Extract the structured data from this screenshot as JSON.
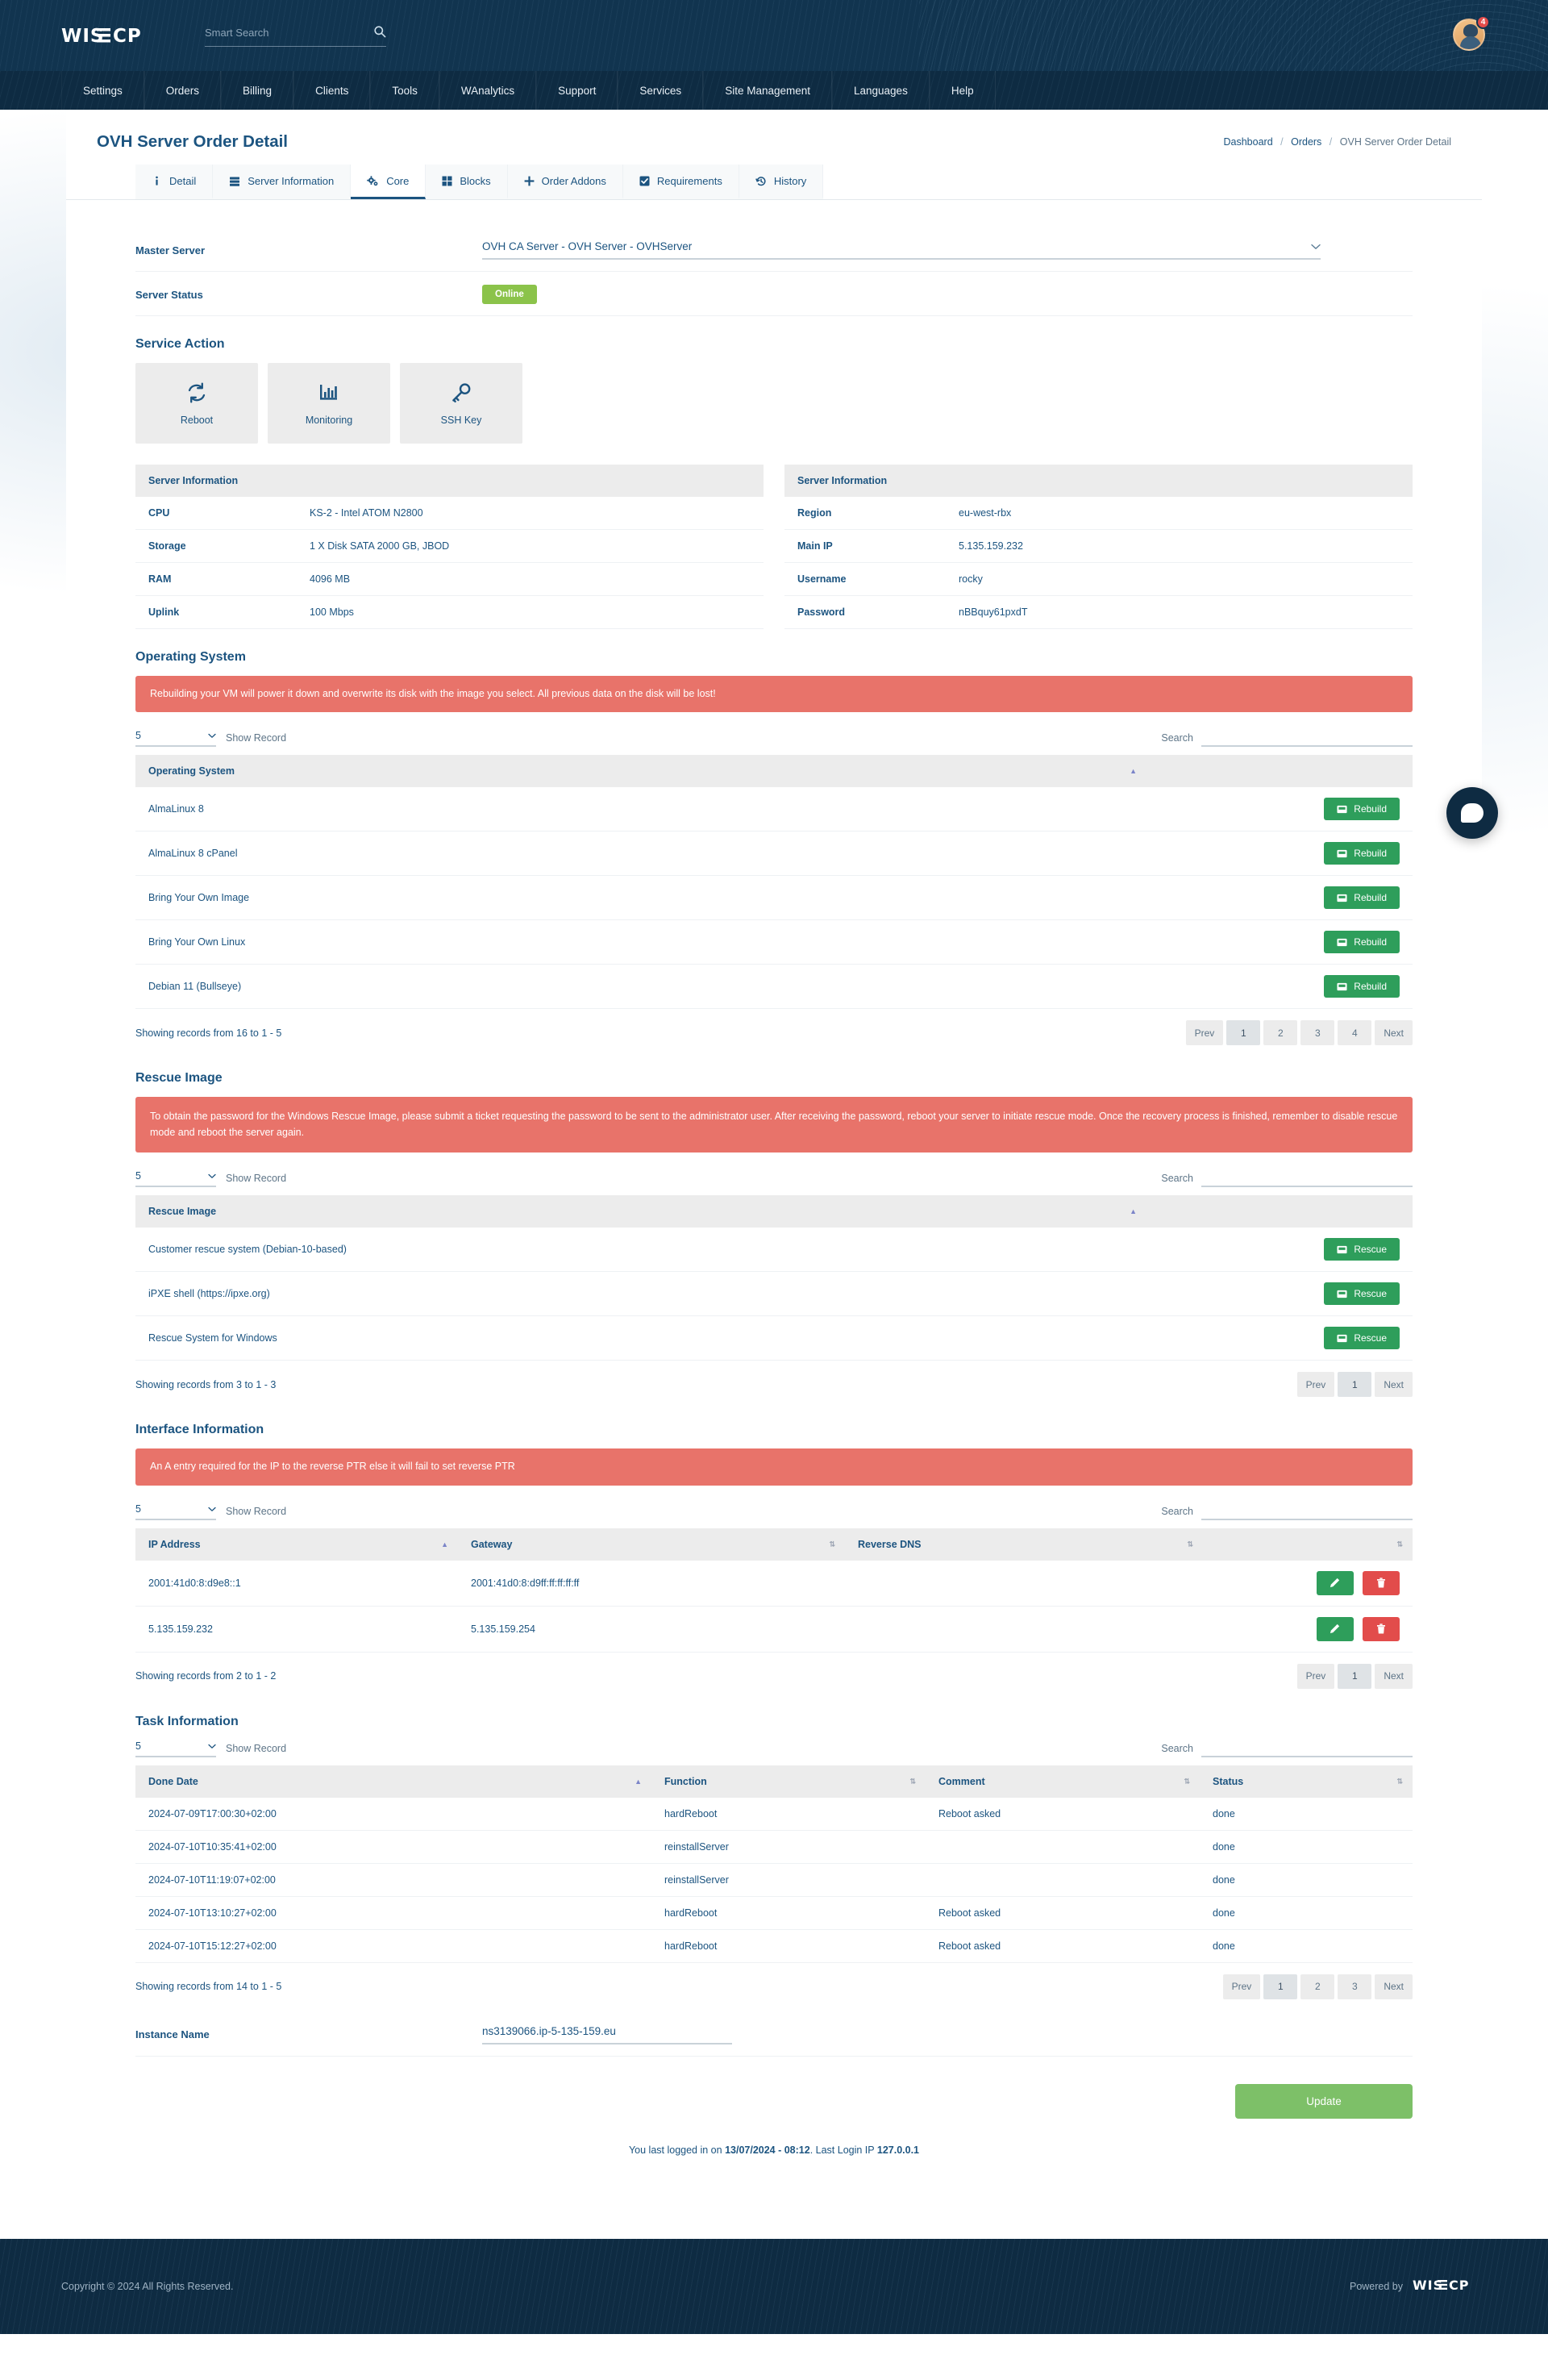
{
  "header": {
    "logo": "WISECP",
    "search_placeholder": "Smart Search",
    "search_value": "",
    "search_icon": "search-icon",
    "notification_count": "4"
  },
  "nav": {
    "items": [
      {
        "label": "Settings"
      },
      {
        "label": "Orders"
      },
      {
        "label": "Billing"
      },
      {
        "label": "Clients"
      },
      {
        "label": "Tools"
      },
      {
        "label": "WAnalytics"
      },
      {
        "label": "Support"
      },
      {
        "label": "Services"
      },
      {
        "label": "Site Management"
      },
      {
        "label": "Languages"
      },
      {
        "label": "Help"
      }
    ]
  },
  "page": {
    "title": "OVH Server Order Detail",
    "breadcrumb": {
      "root": "Dashboard",
      "mid": "Orders",
      "current": "OVH Server Order Detail"
    }
  },
  "tabs": [
    {
      "label": "Detail",
      "icon": "info-icon",
      "active": false
    },
    {
      "label": "Server Information",
      "icon": "server-icon",
      "active": false
    },
    {
      "label": "Core",
      "icon": "cogs-icon",
      "active": true
    },
    {
      "label": "Blocks",
      "icon": "blocks-icon",
      "active": false
    },
    {
      "label": "Order Addons",
      "icon": "plus-icon",
      "active": false
    },
    {
      "label": "Requirements",
      "icon": "check-square-icon",
      "active": false
    },
    {
      "label": "History",
      "icon": "history-icon",
      "active": false
    }
  ],
  "form": {
    "master_server_label": "Master Server",
    "master_server_value": "OVH CA Server - OVH Server - OVHServer",
    "server_status_label": "Server Status",
    "server_status_value": "Online",
    "instance_name_label": "Instance Name",
    "instance_name_value": "ns3139066.ip-5-135-159.eu"
  },
  "service_action": {
    "title": "Service Action",
    "cards": [
      {
        "label": "Reboot",
        "icon": "refresh-icon"
      },
      {
        "label": "Monitoring",
        "icon": "chart-bar-icon"
      },
      {
        "label": "SSH Key",
        "icon": "key-icon"
      }
    ]
  },
  "server_info_left": {
    "header": "Server Information",
    "rows": [
      {
        "key": "CPU",
        "value": "KS-2 - Intel ATOM N2800"
      },
      {
        "key": "Storage",
        "value": "1 X Disk SATA 2000 GB, JBOD"
      },
      {
        "key": "RAM",
        "value": "4096 MB"
      },
      {
        "key": "Uplink",
        "value": "100 Mbps"
      }
    ]
  },
  "server_info_right": {
    "header": "Server Information",
    "rows": [
      {
        "key": "Region",
        "value": "eu-west-rbx"
      },
      {
        "key": "Main IP",
        "value": "5.135.159.232"
      },
      {
        "key": "Username",
        "value": "rocky"
      },
      {
        "key": "Password",
        "value": "nBBquy61pxdT"
      }
    ]
  },
  "operating_system": {
    "title": "Operating System",
    "alert": "Rebuilding your VM will power it down and overwrite its disk with the image you select. All previous data on the disk will be lost!",
    "show_record_value": "5",
    "show_record_label": "Show Record",
    "search_label": "Search",
    "search_value": "",
    "column": "Operating System",
    "action_label": "Rebuild",
    "action_icon": "rebuild-icon",
    "rows": [
      {
        "name": "AlmaLinux 8"
      },
      {
        "name": "AlmaLinux 8 cPanel"
      },
      {
        "name": "Bring Your Own Image"
      },
      {
        "name": "Bring Your Own Linux"
      },
      {
        "name": "Debian 11 (Bullseye)"
      }
    ],
    "info": "Showing records from 16 to 1 - 5",
    "pager": [
      "Prev",
      "1",
      "2",
      "3",
      "4",
      "Next"
    ],
    "pager_active": "1"
  },
  "rescue_image": {
    "title": "Rescue Image",
    "alert": "To obtain the password for the Windows Rescue Image, please submit a ticket requesting the password to be sent to the administrator user. After receiving the password, reboot your server to initiate rescue mode. Once the recovery process is finished, remember to disable rescue mode and reboot the server again.",
    "show_record_value": "5",
    "show_record_label": "Show Record",
    "search_label": "Search",
    "search_value": "",
    "column": "Rescue Image",
    "action_label": "Rescue",
    "action_icon": "rescue-icon",
    "rows": [
      {
        "name": "Customer rescue system (Debian-10-based)"
      },
      {
        "name": "iPXE shell (https://ipxe.org)"
      },
      {
        "name": "Rescue System for Windows"
      }
    ],
    "info": "Showing records from 3 to 1 - 3",
    "pager": [
      "Prev",
      "1",
      "Next"
    ],
    "pager_active": "1"
  },
  "interface_information": {
    "title": "Interface Information",
    "alert": "An A entry required for the IP to the reverse PTR else it will fail to set reverse PTR",
    "show_record_value": "5",
    "show_record_label": "Show Record",
    "search_label": "Search",
    "search_value": "",
    "columns": [
      "IP Address",
      "Gateway",
      "Reverse DNS",
      ""
    ],
    "rows": [
      {
        "ip": "2001:41d0:8:d9e8::1",
        "gateway": "2001:41d0:8:d9ff:ff:ff:ff:ff",
        "rdns": ""
      },
      {
        "ip": "5.135.159.232",
        "gateway": "5.135.159.254",
        "rdns": ""
      }
    ],
    "edit_icon": "pencil-icon",
    "delete_icon": "trash-icon",
    "info": "Showing records from 2 to 1 - 2",
    "pager": [
      "Prev",
      "1",
      "Next"
    ],
    "pager_active": "1"
  },
  "task_information": {
    "title": "Task Information",
    "show_record_value": "5",
    "show_record_label": "Show Record",
    "search_label": "Search",
    "search_value": "",
    "columns": [
      "Done Date",
      "Function",
      "Comment",
      "Status"
    ],
    "rows": [
      {
        "date": "2024-07-09T17:00:30+02:00",
        "function": "hardReboot",
        "comment": "Reboot asked",
        "status": "done"
      },
      {
        "date": "2024-07-10T10:35:41+02:00",
        "function": "reinstallServer",
        "comment": "",
        "status": "done"
      },
      {
        "date": "2024-07-10T11:19:07+02:00",
        "function": "reinstallServer",
        "comment": "",
        "status": "done"
      },
      {
        "date": "2024-07-10T13:10:27+02:00",
        "function": "hardReboot",
        "comment": "Reboot asked",
        "status": "done"
      },
      {
        "date": "2024-07-10T15:12:27+02:00",
        "function": "hardReboot",
        "comment": "Reboot asked",
        "status": "done"
      }
    ],
    "info": "Showing records from 14 to 1 - 5",
    "pager": [
      "Prev",
      "1",
      "2",
      "3",
      "Next"
    ],
    "pager_active": "1"
  },
  "update_button": "Update",
  "last_login": {
    "prefix": "You last logged in on ",
    "date": "13/07/2024 - 08:12",
    "mid": ". Last Login IP ",
    "ip": "127.0.0.1"
  },
  "footer": {
    "copyright": "Copyright © 2024 All Rights Reserved.",
    "powered_by": "Powered by",
    "logo": "WISECP"
  },
  "chat": {
    "icon": "chat-bubble-icon"
  },
  "colors": {
    "brand_dark": "#11344f",
    "nav_dark": "#0e2b42",
    "accent_blue": "#1c5480",
    "green": "#2e9e5b",
    "green_light": "#8bc34a",
    "update_green": "#7dc068",
    "alert_red": "#e8736a",
    "delete_red": "#e24c4b"
  }
}
